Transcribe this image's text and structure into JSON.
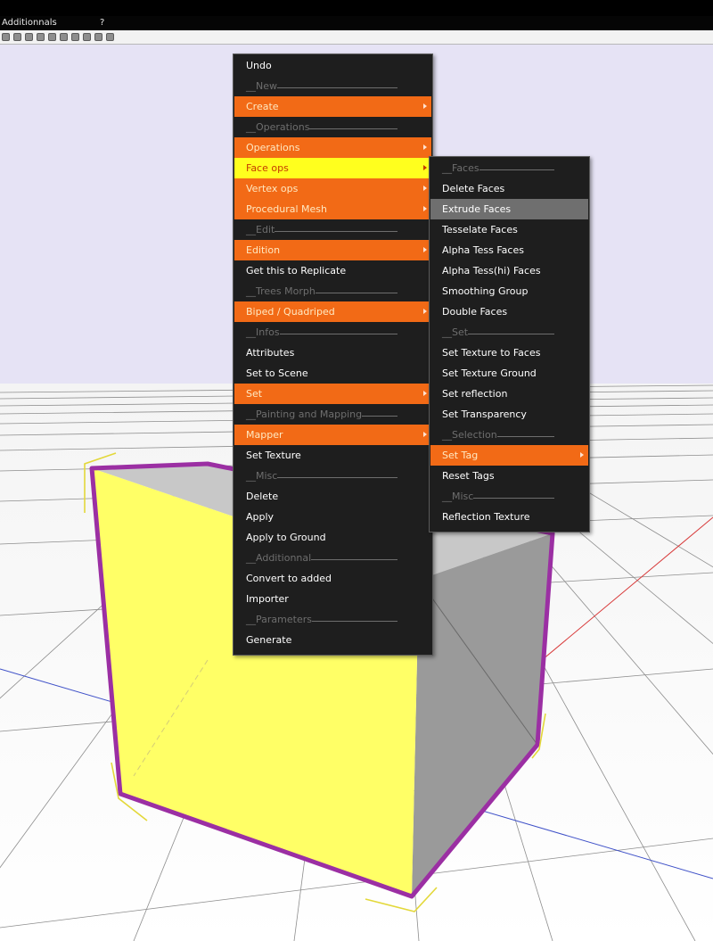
{
  "menubar": {
    "items": [
      "Additionnals",
      "?"
    ]
  },
  "toolbar": {
    "icons": [
      "tool-icon-1",
      "tool-icon-2",
      "tool-icon-3",
      "tool-icon-4",
      "tool-icon-5",
      "tool-icon-6",
      "tool-icon-7",
      "tool-icon-8",
      "tool-icon-9",
      "tool-icon-10"
    ]
  },
  "colors": {
    "menu_bg": "#1e1e1e",
    "accent_orange": "#f26a16",
    "highlight_yellow": "#ffff1e",
    "hover_gray": "#6f6f6f",
    "viewport_sky": "#e6e3f5",
    "cube_yellow": "#ffff66",
    "selection_purple": "#9b2fa3"
  },
  "context_menu": {
    "items": [
      {
        "label": "Undo",
        "kind": "normal"
      },
      {
        "label": "__New",
        "kind": "separator"
      },
      {
        "label": "Create",
        "kind": "orange",
        "submenu": true
      },
      {
        "label": "__Operations",
        "kind": "separator"
      },
      {
        "label": "Operations",
        "kind": "orange",
        "submenu": true
      },
      {
        "label": "Face ops",
        "kind": "yellow",
        "submenu": true
      },
      {
        "label": "Vertex ops",
        "kind": "orange",
        "submenu": true
      },
      {
        "label": "Procedural Mesh",
        "kind": "orange",
        "submenu": true
      },
      {
        "label": "__Edit",
        "kind": "separator"
      },
      {
        "label": "Edition",
        "kind": "orange",
        "submenu": true
      },
      {
        "label": "Get this to Replicate",
        "kind": "normal"
      },
      {
        "label": "__Trees Morph",
        "kind": "separator"
      },
      {
        "label": "Biped / Quadriped",
        "kind": "orange",
        "submenu": true
      },
      {
        "label": "__Infos",
        "kind": "separator"
      },
      {
        "label": "Attributes",
        "kind": "normal"
      },
      {
        "label": "Set to Scene",
        "kind": "normal"
      },
      {
        "label": "Set",
        "kind": "orange",
        "submenu": true
      },
      {
        "label": "__Painting and Mapping",
        "kind": "separator"
      },
      {
        "label": "Mapper",
        "kind": "orange",
        "submenu": true
      },
      {
        "label": "Set Texture",
        "kind": "normal"
      },
      {
        "label": "__Misc",
        "kind": "separator"
      },
      {
        "label": "Delete",
        "kind": "normal"
      },
      {
        "label": "Apply",
        "kind": "normal"
      },
      {
        "label": "Apply to Ground",
        "kind": "normal"
      },
      {
        "label": "__Additionnal",
        "kind": "separator"
      },
      {
        "label": "Convert to added",
        "kind": "normal"
      },
      {
        "label": "Importer",
        "kind": "normal"
      },
      {
        "label": "__Parameters",
        "kind": "separator"
      },
      {
        "label": "Generate",
        "kind": "normal"
      }
    ]
  },
  "face_ops_submenu": {
    "items": [
      {
        "label": "__Faces",
        "kind": "separator"
      },
      {
        "label": "Delete Faces",
        "kind": "normal"
      },
      {
        "label": "Extrude Faces",
        "kind": "hover"
      },
      {
        "label": "Tesselate Faces",
        "kind": "normal"
      },
      {
        "label": "Alpha Tess Faces",
        "kind": "normal"
      },
      {
        "label": "Alpha Tess(hi) Faces",
        "kind": "normal"
      },
      {
        "label": "Smoothing Group",
        "kind": "normal"
      },
      {
        "label": "Double Faces",
        "kind": "normal"
      },
      {
        "label": "__Set",
        "kind": "separator"
      },
      {
        "label": "Set Texture to Faces",
        "kind": "normal"
      },
      {
        "label": "Set Texture Ground",
        "kind": "normal"
      },
      {
        "label": "Set reflection",
        "kind": "normal"
      },
      {
        "label": "Set Transparency",
        "kind": "normal"
      },
      {
        "label": "__Selection",
        "kind": "separator"
      },
      {
        "label": "Set Tag",
        "kind": "orange",
        "submenu": true
      },
      {
        "label": "Reset Tags",
        "kind": "normal"
      },
      {
        "label": "__Misc",
        "kind": "separator"
      },
      {
        "label": "Reflection Texture",
        "kind": "normal"
      }
    ]
  }
}
